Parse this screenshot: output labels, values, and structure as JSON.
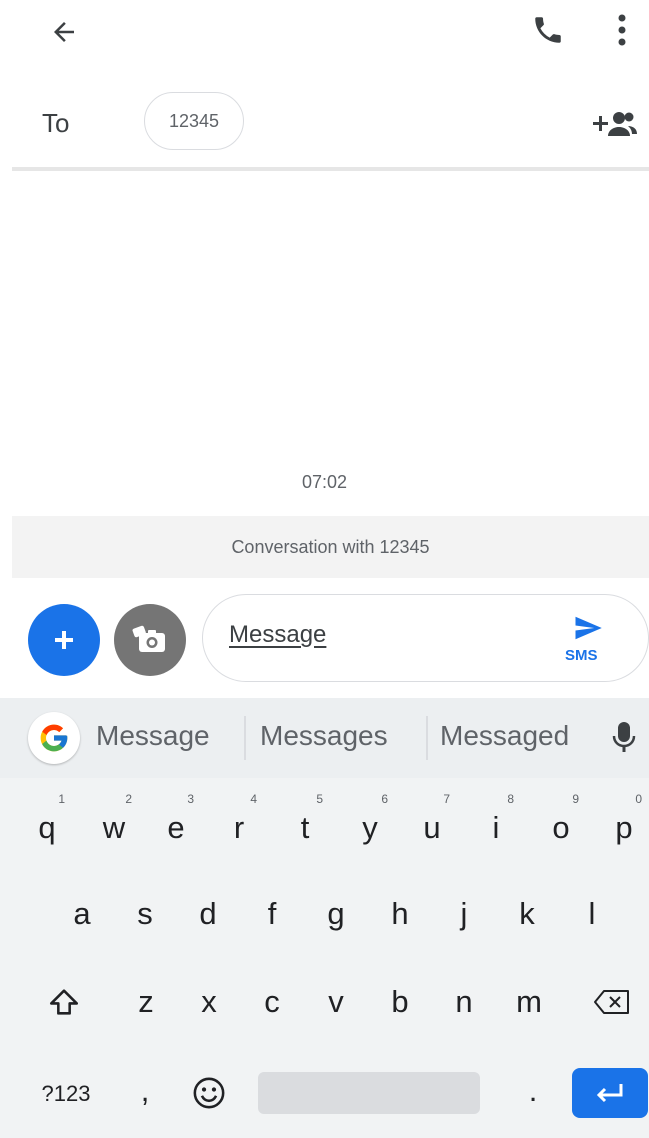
{
  "header": {
    "back_icon": "arrow-back-icon",
    "call_icon": "phone-icon",
    "menu_icon": "more-vert-icon"
  },
  "recipient": {
    "to_label": "To",
    "chip_value": "12345",
    "add_contact_icon": "add-person-icon"
  },
  "conversation": {
    "timestamp": "07:02",
    "banner": "Conversation with 12345"
  },
  "compose": {
    "placeholder": "Message",
    "send_label": "SMS",
    "accent_color": "#1a73e8"
  },
  "keyboard": {
    "suggestions": [
      "Message",
      "Messages",
      "Messaged"
    ],
    "row1": [
      {
        "key": "q",
        "sup": "1"
      },
      {
        "key": "w",
        "sup": "2"
      },
      {
        "key": "e",
        "sup": "3"
      },
      {
        "key": "r",
        "sup": "4"
      },
      {
        "key": "t",
        "sup": "5"
      },
      {
        "key": "y",
        "sup": "6"
      },
      {
        "key": "u",
        "sup": "7"
      },
      {
        "key": "i",
        "sup": "8"
      },
      {
        "key": "o",
        "sup": "9"
      },
      {
        "key": "p",
        "sup": "0"
      }
    ],
    "row2": [
      "a",
      "s",
      "d",
      "f",
      "g",
      "h",
      "j",
      "k",
      "l"
    ],
    "row3": [
      "z",
      "x",
      "c",
      "v",
      "b",
      "n",
      "m"
    ],
    "symbols_key": "?123",
    "comma_key": ",",
    "period_key": "."
  }
}
